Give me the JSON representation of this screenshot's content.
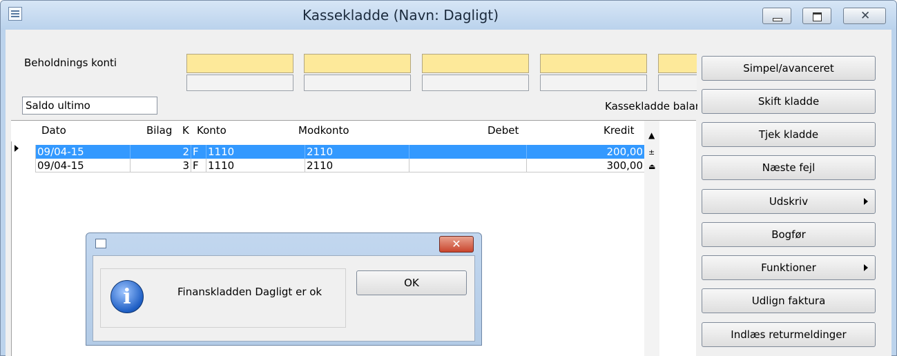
{
  "window": {
    "title": "Kassekladde (Navn: Dagligt)"
  },
  "fields": {
    "beholdnings_label": "Beholdnings konti",
    "saldo_label": "Saldo ultimo",
    "kassekladde_balance_label": "Kassekladde balance"
  },
  "grid": {
    "columns": [
      "Dato",
      "Bilag",
      "K",
      "Konto",
      "Modkonto",
      "Debet",
      "Kredit"
    ],
    "rows": [
      {
        "dato": "09/04-15",
        "bilag": "2",
        "k": "F",
        "konto": "1110",
        "modkonto": "2110",
        "debet": "",
        "kredit": "200,00"
      },
      {
        "dato": "09/04-15",
        "bilag": "3",
        "k": "F",
        "konto": "1110",
        "modkonto": "2110",
        "debet": "",
        "kredit": "300,00"
      }
    ]
  },
  "buttons": {
    "simpel": "Simpel/avanceret",
    "skift": "Skift kladde",
    "tjek": "Tjek kladde",
    "naeste": "Næste fejl",
    "udskriv": "Udskriv",
    "bogfoer": "Bogfør",
    "funktioner": "Funktioner",
    "udlign": "Udlign faktura",
    "indlaes": "Indlæs returmeldinger"
  },
  "dialog": {
    "message": "Finanskladden Dagligt er ok",
    "ok_label": "OK",
    "close_glyph": "✕"
  },
  "colors": {
    "selection": "#3399ff",
    "yellow_field": "#fde99a",
    "title_bar": "#bad2ec"
  }
}
